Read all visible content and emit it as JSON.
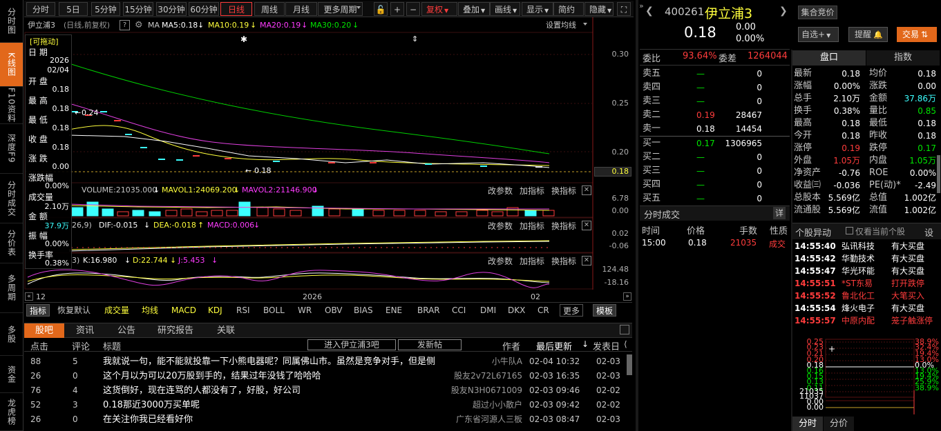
{
  "sidetabs": [
    "分时图",
    "K线图",
    "F10资料",
    "深度F9",
    "分时成交",
    "分价表",
    "多周期",
    "多股",
    "资金",
    "龙虎榜"
  ],
  "toolbar": {
    "items": [
      "分时",
      "5日",
      "5分钟",
      "15分钟",
      "30分钟",
      "60分钟",
      "日线",
      "周线",
      "月线",
      "更多周期",
      "复权",
      "叠加",
      "画线",
      "显示",
      "简约",
      "隐藏"
    ],
    "icons": [
      "lock-icon",
      "plus-icon",
      "minus-icon",
      "fullscreen-icon",
      "double-arrow-icon"
    ]
  },
  "chartinfo": {
    "name": "伊立浦3",
    "mode": "(日线,前复权)",
    "help": "?",
    "ma_label": "MA",
    "ma5": "MA5:0.18",
    "ma10": "MA10:0.19",
    "ma20": "MA20:0.19",
    "ma30": "MA30:0.20",
    "settings": "设置均线"
  },
  "kaxis": [
    "0.30",
    "0.25",
    "0.20",
    "0.18"
  ],
  "kmarks": {
    "high": "0.24",
    "low": "0.18"
  },
  "tooltip": {
    "drag": "[可拖动]",
    "date_label": "日 期",
    "date_year": "2026",
    "date": "02/04",
    "open_label": "开 盘",
    "open": "0.18",
    "high_label": "最 高",
    "high": "0.18",
    "low_label": "最 低",
    "low": "0.18",
    "close_label": "收 盘",
    "close": "0.18",
    "chg_label": "涨 跌",
    "chg": "0.00",
    "pct_label": "涨跌幅",
    "pct": "0.00%",
    "vol_label": "成交量",
    "vol": "2.10万",
    "amt_label": "金 额",
    "amt": "37.9万",
    "amp_label": "振 幅",
    "amp": "0.00%",
    "turn_label": "换手率",
    "turn": "0.38%"
  },
  "vol": {
    "v": "VOLUME:21035.000",
    "m1": "MAVOL1:24069.200",
    "m2": "MAVOL2:21146.900",
    "axis": [
      "6.78",
      "0.00"
    ]
  },
  "macd": {
    "p": "26,9)",
    "dif": "DIF:-0.015",
    "dea": "DEA:-0.018",
    "macd": "MACD:0.006",
    "axis": [
      "0.02",
      "-0.06"
    ]
  },
  "kdj": {
    "p": "3)",
    "k": "K:16.980",
    "d": "D:22.744",
    "j": "J:5.453",
    "axis": [
      "124.48",
      "-18.16"
    ]
  },
  "panelctl": [
    "改参数",
    "加指标",
    "换指标"
  ],
  "timeaxis": [
    "12",
    "2026",
    "02"
  ],
  "indtabs": [
    "指标",
    "恢复默认",
    "成交量",
    "均线",
    "MACD",
    "KDJ",
    "RSI",
    "BOLL",
    "WR",
    "OBV",
    "BIAS",
    "ENE",
    "BRAR",
    "CCI",
    "DMI",
    "DKX",
    "CR",
    "更多",
    "模板"
  ],
  "forum": {
    "tabs": [
      "股吧",
      "资讯",
      "公告",
      "研究报告",
      "关联"
    ],
    "cols": [
      "点击",
      "评论",
      "标题",
      "作者",
      "最后更新",
      "发表日"
    ],
    "enter": "进入伊立浦3吧",
    "post": "发新帖",
    "rows": [
      {
        "clicks": "88",
        "comments": "5",
        "title": "我就说一句，能不能就投靠一下小熊电器呢？同属佛山市。虽然是竞争对手，但是侧",
        "author": "小牛队A",
        "updated": "02-04 10:32",
        "date": "02-03"
      },
      {
        "clicks": "26",
        "comments": "0",
        "title": "这个月以为可以20万股到手的，结果过年没钱了哈哈哈",
        "author": "股友2v72L67165",
        "updated": "02-03 16:35",
        "date": "02-03"
      },
      {
        "clicks": "76",
        "comments": "4",
        "title": "这货倒好，现在连骂的人都没有了，好股，好公司",
        "author": "股友N3H0671009",
        "updated": "02-03 09:46",
        "date": "02-02"
      },
      {
        "clicks": "52",
        "comments": "3",
        "title": "0.18那近3000万买单呢",
        "author": "超过小小散户",
        "updated": "02-03 09:42",
        "date": "02-02"
      },
      {
        "clicks": "26",
        "comments": "0",
        "title": "在关注你我已经看好你",
        "author": "广东省河源人三板",
        "updated": "02-03 08:47",
        "date": "02-03"
      }
    ]
  },
  "quote": {
    "code": "400261",
    "name": "伊立浦3",
    "badge": "集合竞价",
    "price": "0.18",
    "chg": "0.00",
    "pct": "0.00%",
    "btn_watch": "自选+",
    "btn_alert": "提醒",
    "btn_trade": "交易",
    "weibi_label": "委比",
    "weibi": "93.64%",
    "weicha_label": "委差",
    "weicha": "1264044",
    "asks": [
      {
        "l": "卖五",
        "p": "—",
        "v": "0"
      },
      {
        "l": "卖四",
        "p": "—",
        "v": "0"
      },
      {
        "l": "卖三",
        "p": "—",
        "v": "0"
      },
      {
        "l": "卖二",
        "p": "0.19",
        "v": "28467"
      },
      {
        "l": "卖一",
        "p": "0.18",
        "v": "14454"
      }
    ],
    "bids": [
      {
        "l": "买一",
        "p": "0.17",
        "v": "1306965"
      },
      {
        "l": "买二",
        "p": "—",
        "v": "0"
      },
      {
        "l": "买三",
        "p": "—",
        "v": "0"
      },
      {
        "l": "买四",
        "p": "—",
        "v": "0"
      },
      {
        "l": "买五",
        "p": "—",
        "v": "0"
      }
    ],
    "trades_title": "分时成交",
    "detail": "详",
    "trade_cols": [
      "时间",
      "价格",
      "手数",
      "性质"
    ],
    "trades": [
      {
        "t": "15:00",
        "p": "0.18",
        "v": "21035",
        "n": "成交"
      }
    ],
    "tabs": [
      "盘口",
      "指数"
    ],
    "stats": [
      [
        "最新",
        "0.18",
        "均价",
        "0.18"
      ],
      [
        "涨幅",
        "0.00%",
        "涨跌",
        "0.00"
      ],
      [
        "总手",
        "2.10万",
        "金额",
        "37.86万"
      ],
      [
        "换手",
        "0.38%",
        "量比",
        "0.85"
      ],
      [
        "最高",
        "0.18",
        "最低",
        "0.18"
      ],
      [
        "今开",
        "0.18",
        "昨收",
        "0.18"
      ],
      [
        "涨停",
        "0.19",
        "跌停",
        "0.17"
      ],
      [
        "外盘",
        "1.05万",
        "内盘",
        "1.05万"
      ],
      [
        "净资产",
        "-0.76",
        "ROE",
        "0.00%"
      ],
      [
        "收益㈢",
        "-0.036",
        "PE(动)*",
        "-2.49"
      ],
      [
        "总股本",
        "5.569亿",
        "总值",
        "1.002亿"
      ],
      [
        "流通股",
        "5.569亿",
        "流值",
        "1.002亿"
      ]
    ],
    "alerts_title": "个股异动",
    "alerts_chk": "仅看当前个股",
    "alerts_set": "设",
    "alerts": [
      {
        "t": "14:55:40",
        "n": "弘讯科技",
        "e": "有大买盘",
        "c": "white"
      },
      {
        "t": "14:55:42",
        "n": "华勤技术",
        "e": "有大买盘",
        "c": "white"
      },
      {
        "t": "14:55:47",
        "n": "华光环能",
        "e": "有大买盘",
        "c": "white"
      },
      {
        "t": "14:55:51",
        "n": "*ST东易",
        "e": "打开跌停",
        "c": "red"
      },
      {
        "t": "14:55:52",
        "n": "鲁北化工",
        "e": "大笔买入",
        "c": "red"
      },
      {
        "t": "14:55:54",
        "n": "烽火电子",
        "e": "有大买盘",
        "c": "white"
      },
      {
        "t": "14:55:57",
        "n": "中原内配",
        "e": "笼子触涨停",
        "c": "red"
      }
    ],
    "mini_left": [
      "0.25",
      "0.23",
      "0.21",
      "0.20",
      "0.18",
      "0.16",
      "0.15",
      "0.13",
      "0.11",
      "21035",
      "11037",
      "0.00",
      "0.00"
    ],
    "mini_right": [
      "38.9%",
      "32.4%",
      "19.4%",
      "13.0%",
      "0.0%",
      "13.0%",
      "19.4%",
      "25.9%",
      "38.9%"
    ],
    "bottom_tabs": [
      "分时",
      "分价"
    ]
  }
}
